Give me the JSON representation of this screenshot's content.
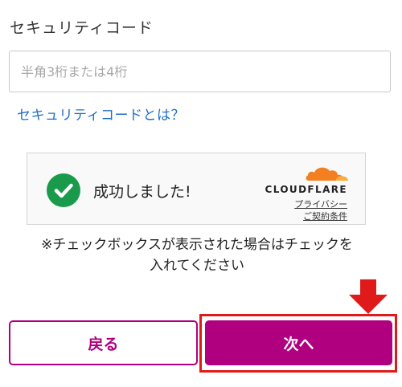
{
  "security_code": {
    "label": "セキュリティコード",
    "placeholder": "半角3桁または4桁",
    "value": "",
    "help_link": "セキュリティコードとは？"
  },
  "captcha": {
    "status_text": "成功しました!",
    "brand": "CLOUDFLARE",
    "privacy_link": "プライバシー",
    "terms_link": "ご契約条件",
    "check_color": "#1a9a4b",
    "logo_color": "#f38020"
  },
  "notice": {
    "line1": "※チェックボックスが表示された場合はチェックを",
    "line2": "入れてください"
  },
  "buttons": {
    "back_label": "戻る",
    "next_label": "次へ"
  },
  "colors": {
    "brand_magenta": "#b0007f",
    "link_blue": "#1f6fc5",
    "annotation_red": "#e01a1a"
  }
}
